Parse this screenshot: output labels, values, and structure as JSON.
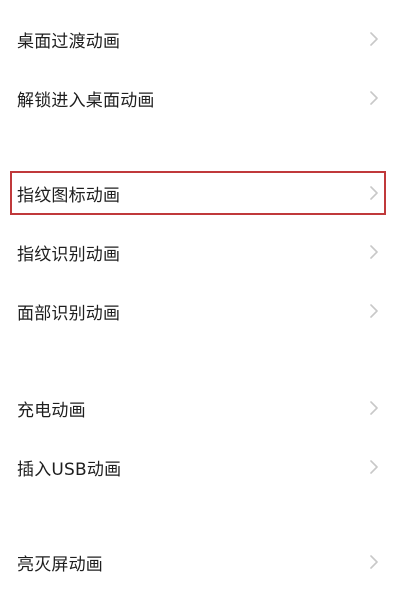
{
  "settings_list": {
    "items": [
      {
        "label": "桌面过渡动画"
      },
      {
        "label": "解锁进入桌面动画"
      },
      {
        "label": "指纹图标动画"
      },
      {
        "label": "指纹识别动画"
      },
      {
        "label": "面部识别动画"
      },
      {
        "label": "充电动画"
      },
      {
        "label": "插入USB动画"
      },
      {
        "label": "亮灭屏动画"
      }
    ]
  },
  "colors": {
    "highlight_border": "#c0393b",
    "chevron": "#c8c8c8",
    "text": "#1e1e1e"
  },
  "icons": {
    "chevron": "chevron-right-icon"
  }
}
